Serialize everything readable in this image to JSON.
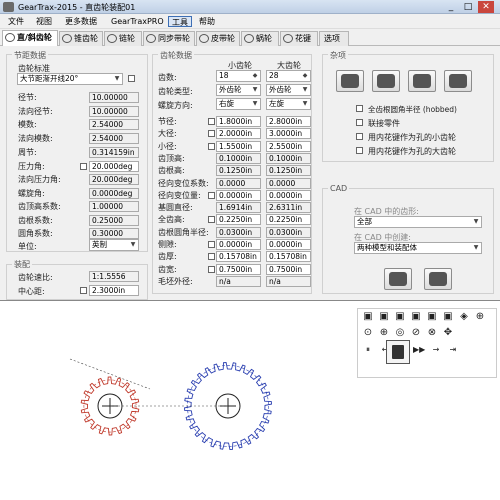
{
  "window": {
    "title": "GearTrax-2015 - 直齿轮装配01",
    "min": "_",
    "max": "□",
    "close": "✕"
  },
  "menu": [
    "文件",
    "视图",
    "更多数据",
    "GearTraxPRO",
    "工具",
    "帮助"
  ],
  "tabs": [
    "直/斜齿轮",
    "锥齿轮",
    "链轮",
    "同步带轮",
    "皮带轮",
    "蜗轮",
    "花键",
    "选项"
  ],
  "pitch": {
    "title": "节距数据",
    "standard_label": "齿轮标准",
    "standard_value": "大节距渐开线20°",
    "rows": [
      {
        "label": "径节:",
        "value": "10.00000"
      },
      {
        "label": "法向径节:",
        "value": "10.00000"
      },
      {
        "label": "模数:",
        "value": "2.54000"
      },
      {
        "label": "法向模数:",
        "value": "2.54000"
      },
      {
        "label": "周节:",
        "value": "0.314159in"
      },
      {
        "label": "压力角:",
        "value": "20.000deg"
      },
      {
        "label": "法向压力角:",
        "value": "20.000deg"
      },
      {
        "label": "螺旋角:",
        "value": "0.0000deg"
      }
    ],
    "rows2": [
      {
        "label": "齿顶高系数:",
        "value": "1.00000"
      },
      {
        "label": "齿根系数:",
        "value": "0.25000"
      },
      {
        "label": "圆角系数:",
        "value": "0.30000"
      }
    ],
    "unit_label": "单位:",
    "unit_value": "英制"
  },
  "assembly": {
    "title": "装配",
    "ratio_label": "齿轮速比:",
    "ratio_value": "1:1.5556",
    "center_label": "中心距:",
    "center_value": "2.3000in"
  },
  "gear": {
    "title": "齿轮数据",
    "small_label": "小齿轮",
    "big_label": "大齿轮",
    "teeth_label": "齿数:",
    "teeth": [
      "18",
      "28"
    ],
    "type_label": "齿轮类型:",
    "type": [
      "外齿轮",
      "外齿轮"
    ],
    "hand_label": "螺旋方向:",
    "hand": [
      "右旋",
      "左旋"
    ],
    "rows": [
      {
        "label": "节径:",
        "chk": true,
        "a": "1.8000in",
        "b": "2.8000in"
      },
      {
        "label": "大径:",
        "chk": true,
        "a": "2.0000in",
        "b": "3.0000in"
      },
      {
        "label": "小径:",
        "chk": true,
        "a": "1.5500in",
        "b": "2.5500in"
      },
      {
        "label": "齿顶高:",
        "chk": false,
        "a": "0.1000in",
        "b": "0.1000in"
      },
      {
        "label": "齿根高:",
        "chk": false,
        "a": "0.1250in",
        "b": "0.1250in"
      },
      {
        "label": "径向变位系数:",
        "chk": false,
        "a": "0.0000",
        "b": "0.0000"
      },
      {
        "label": "径向变位量:",
        "chk": true,
        "a": "0.0000in",
        "b": "0.0000in"
      },
      {
        "label": "基圆直径:",
        "chk": false,
        "a": "1.6914in",
        "b": "2.6311in"
      },
      {
        "label": "全齿高:",
        "chk": true,
        "a": "0.2250in",
        "b": "0.2250in"
      },
      {
        "label": "齿根圆角半径:",
        "chk": false,
        "a": "0.0300in",
        "b": "0.0300in"
      },
      {
        "label": "侧隙:",
        "chk": true,
        "a": "0.0000in",
        "b": "0.0000in"
      },
      {
        "label": "齿厚:",
        "chk": true,
        "a": "0.15708in",
        "b": "0.15708in"
      },
      {
        "label": "齿宽:",
        "chk": true,
        "a": "0.7500in",
        "b": "0.7500in"
      },
      {
        "label": "毛坯外径:",
        "chk": false,
        "a": "n/a",
        "b": "n/a"
      }
    ]
  },
  "options": {
    "title": "杂项",
    "checks": [
      "全齿根圆角半径 (hobbed)",
      "联接零件",
      "用内花键作为孔的小齿轮",
      "用内花键作为孔的大齿轮"
    ]
  },
  "cad": {
    "title": "CAD",
    "in_cad_label": "在 CAD 中的齿形:",
    "in_cad_value": "全部",
    "create_label": "在 CAD 中创建:",
    "create_value": "两种模型和装配体"
  },
  "colors": {
    "small_gear": "#c0392b",
    "big_gear": "#2a3fb0"
  },
  "toolbox_icons": [
    "cube-icon",
    "cube-icon",
    "cube-icon",
    "cube-icon",
    "cube-icon",
    "cube-icon",
    "cube-icon",
    "shade-icon",
    "zoom-icon",
    "rotate-icon",
    "zoom-icon",
    "zoom-icon",
    "pan-icon",
    "move-icon"
  ],
  "play_icons": [
    "⏸",
    "←",
    "◀◀",
    "▶▶",
    "→",
    "⇥"
  ]
}
